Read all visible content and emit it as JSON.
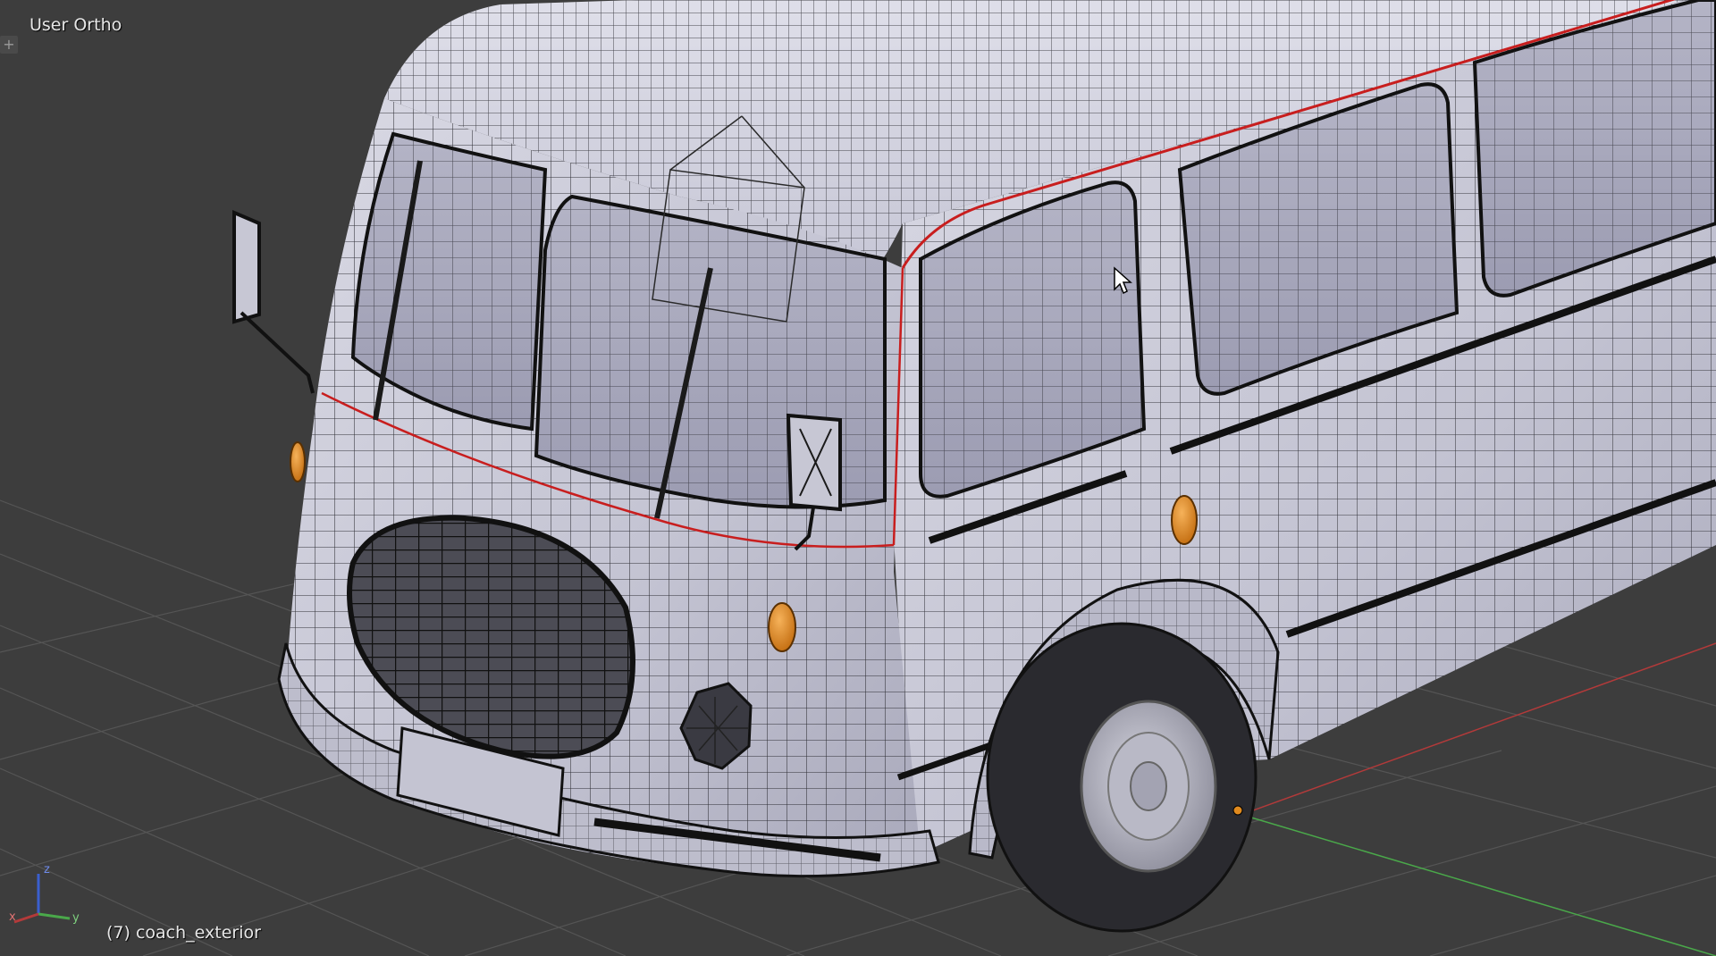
{
  "viewport": {
    "view_name": "User Ortho",
    "object_info": "(7) coach_exterior",
    "add_widget_glyph": "+"
  },
  "gizmo": {
    "x_label": "x",
    "y_label": "y",
    "z_label": "z"
  },
  "colors": {
    "background": "#3d3d3d",
    "grid": "#555555",
    "x_axis": "#b33a3a",
    "y_axis": "#4aa84a",
    "z_axis": "#3a5fcf",
    "mesh_fill": "#c9c9d6",
    "wire": "#1a1a1a",
    "selected_edge": "#c81e1e",
    "turn_signal": "#e08a1e"
  },
  "icons": [
    "add-icon",
    "mouse-cursor-icon",
    "axis-gizmo-icon"
  ]
}
